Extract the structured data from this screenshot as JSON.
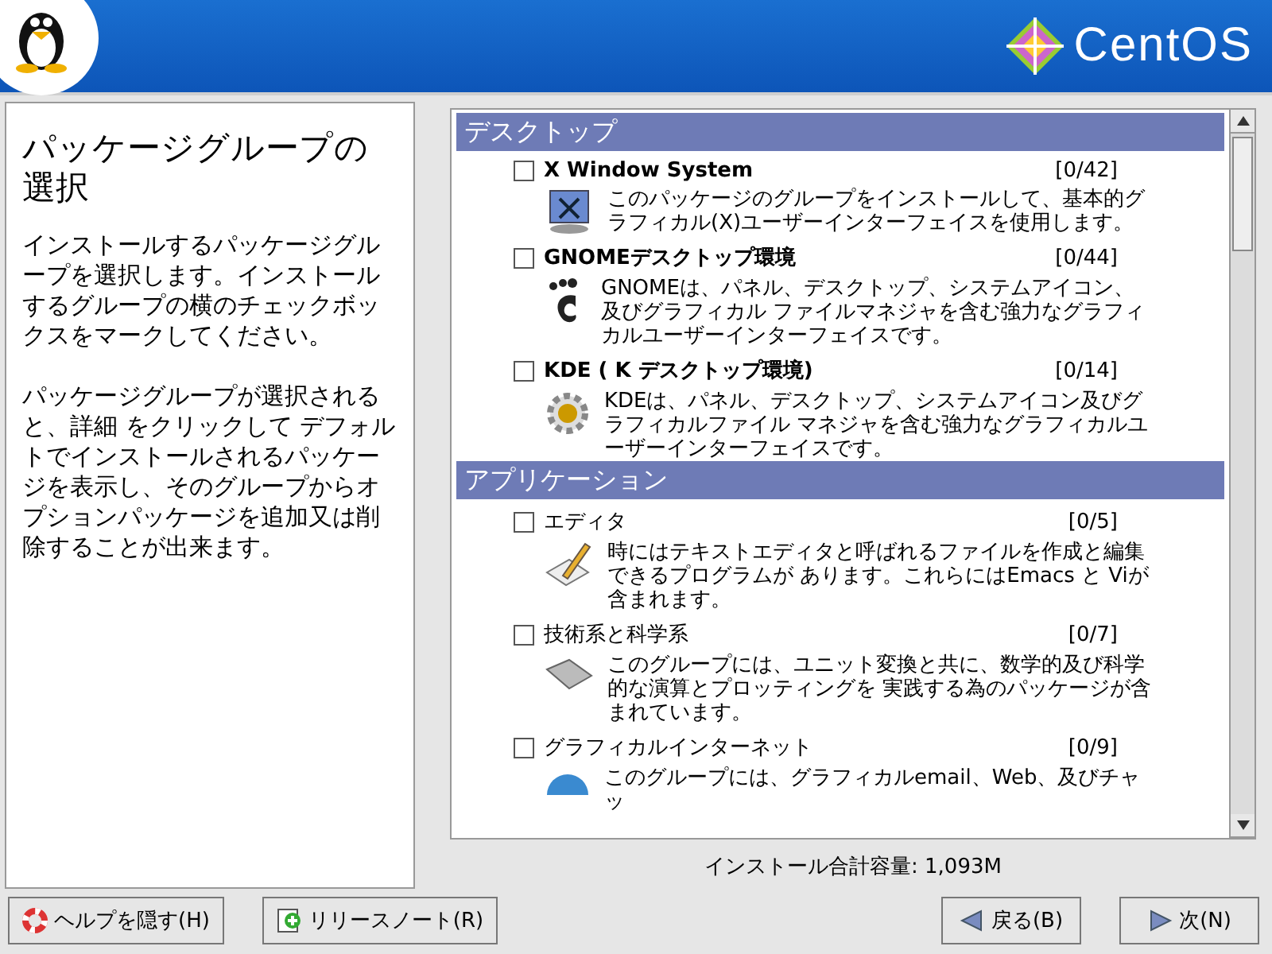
{
  "header": {
    "logo_text": "CentOS"
  },
  "help": {
    "title": "パッケージグループの選択",
    "paragraphs": [
      "インストールするパッケージグループを選択します。インストールするグループの横のチェックボックスをマークしてください。",
      "パッケージグループが選択されると、詳細 をクリックして デフォルトでインストールされるパッケージを表示し、そのグループからオプションパッケージを追加又は削除することが出来ます。"
    ]
  },
  "sections": [
    {
      "title": "デスクトップ",
      "groups": [
        {
          "name": "X Window System",
          "count": "[0/42]",
          "checked": false,
          "description": "このパッケージのグループをインストールして、基本的グラフィカル(X)ユーザーインターフェイスを使用します。"
        },
        {
          "name": "GNOMEデスクトップ環境",
          "count": "[0/44]",
          "checked": false,
          "description": "GNOMEは、パネル、デスクトップ、システムアイコン、及びグラフィカル ファイルマネジャを含む強力なグラフィカルユーザーインターフェイスです。"
        },
        {
          "name": "KDE ( K デスクトップ環境)",
          "count": "[0/14]",
          "checked": false,
          "description": "KDEは、パネル、デスクトップ、システムアイコン及びグラフィカルファイル マネジャを含む強力なグラフィカルユーザーインターフェイスです。"
        }
      ]
    },
    {
      "title": "アプリケーション",
      "groups": [
        {
          "name": "エディタ",
          "count": "[0/5]",
          "checked": false,
          "description": "時にはテキストエディタと呼ばれるファイルを作成と編集できるプログラムが あります。これらにはEmacs と Viが含まれます。"
        },
        {
          "name": "技術系と科学系",
          "count": "[0/7]",
          "checked": false,
          "description": "このグループには、ユニット変換と共に、数学的及び科学的な演算とプロッティングを 実践する為のパッケージが含まれています。"
        },
        {
          "name": "グラフィカルインターネット",
          "count": "[0/9]",
          "checked": false,
          "description": "このグループには、グラフィカルemail、Web、及びチャッ"
        }
      ]
    }
  ],
  "total": "インストール合計容量: 1,093M",
  "buttons": [
    {
      "label": "ヘルプを隠す(H)",
      "kind": "help"
    },
    {
      "label": "リリースノート(R)",
      "kind": "notes"
    },
    {
      "label": "戻る(B)",
      "kind": "back"
    },
    {
      "label": "次(N)",
      "kind": "next"
    }
  ]
}
